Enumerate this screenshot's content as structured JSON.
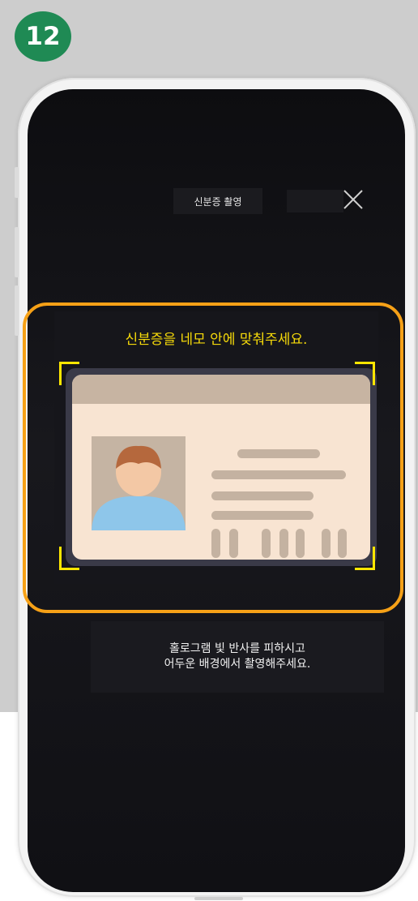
{
  "step": {
    "number": "12"
  },
  "screen": {
    "title": "신분증 촬영",
    "close_icon": "close-icon",
    "instruction": "신분증을 네모 안에 맞춰주세요.",
    "hint_line1": "홀로그램 빛 반사를 피하시고",
    "hint_line2": "어두운 배경에서 촬영해주세요."
  },
  "colors": {
    "badge": "#1f8a54",
    "highlight_frame": "#f6a117",
    "guide_corners": "#ffe600",
    "instruction_text": "#f5d90a"
  }
}
